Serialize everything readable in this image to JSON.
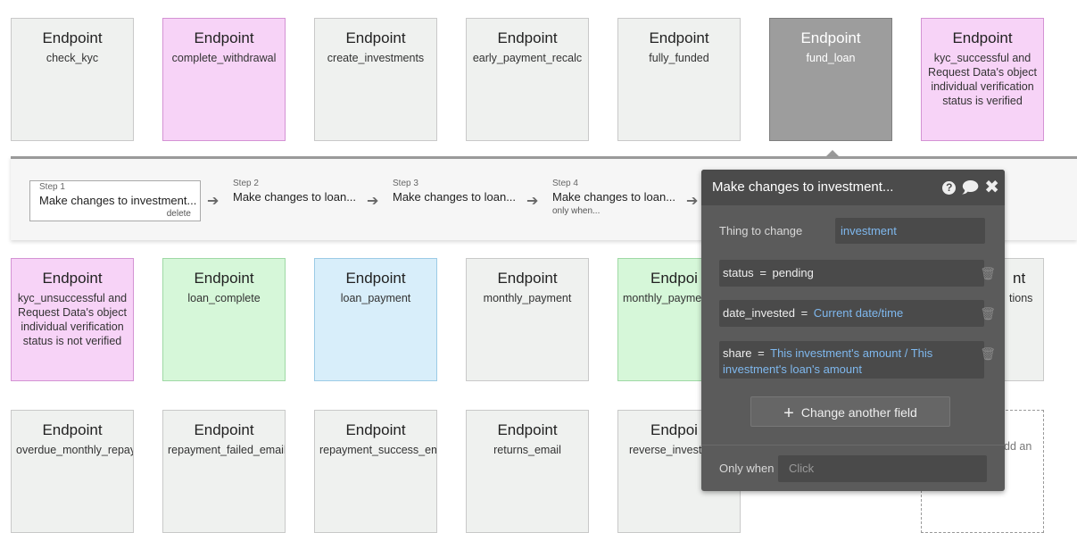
{
  "cards_row1": [
    {
      "title": "Endpoint",
      "sub": "check_kyc"
    },
    {
      "title": "Endpoint",
      "sub": "complete_withdrawal"
    },
    {
      "title": "Endpoint",
      "sub": "create_investments"
    },
    {
      "title": "Endpoint",
      "sub": "early_payment_recalc"
    },
    {
      "title": "Endpoint",
      "sub": "fully_funded"
    },
    {
      "title": "Endpoint",
      "sub": "fund_loan"
    },
    {
      "title": "Endpoint",
      "sub": "kyc_successful and Request Data's object individual verification status is verified"
    }
  ],
  "cards_row2": [
    {
      "title": "Endpoint",
      "sub": "kyc_unsuccessful and Request Data's object individual verification status is not verified"
    },
    {
      "title": "Endpoint",
      "sub": "loan_complete"
    },
    {
      "title": "Endpoint",
      "sub": "loan_payment"
    },
    {
      "title": "Endpoint",
      "sub": "monthly_payment"
    },
    {
      "title": "Endpoi",
      "sub": "monthly_payme"
    },
    {
      "title": "nt",
      "sub": "tions"
    }
  ],
  "cards_row3": [
    {
      "title": "Endpoint",
      "sub": "overdue_monthly_repay"
    },
    {
      "title": "Endpoint",
      "sub": "repayment_failed_email"
    },
    {
      "title": "Endpoint",
      "sub": "repayment_success_em"
    },
    {
      "title": "Endpoint",
      "sub": "returns_email"
    },
    {
      "title": "Endpoi",
      "sub": "reverse_invest"
    },
    {
      "title": "",
      "sub": "dd an"
    }
  ],
  "workflow": {
    "steps": [
      {
        "label": "Step 1",
        "name": "Make changes to investment...",
        "sub": "delete"
      },
      {
        "label": "Step 2",
        "name": "Make changes to loan...",
        "sub": ""
      },
      {
        "label": "Step 3",
        "name": "Make changes to loan...",
        "sub": ""
      },
      {
        "label": "Step 4",
        "name": "Make changes to loan...",
        "sub": "only when..."
      }
    ]
  },
  "panel": {
    "title": "Make changes to investment...",
    "help_icon": "?",
    "thing_label": "Thing to change",
    "thing_value": "investment",
    "fields": [
      {
        "name": "status",
        "eq": "=",
        "value": "pending"
      },
      {
        "name": "date_invested",
        "eq": "=",
        "value": "Current date/time"
      },
      {
        "name": "share",
        "eq": "=",
        "value": "This investment's amount / This investment's loan's amount"
      }
    ],
    "add_button": "Change another field",
    "only_when_label": "Only when",
    "only_when_value": "Click"
  },
  "colors": {
    "pink_card": "#f7d3f7",
    "green_card": "#d6f7d9",
    "blue_card": "#d8eefa",
    "gray_card": "#eff1ef",
    "selected_card": "#9d9d9d",
    "panel_bg": "#5b5b5b",
    "expression_blue": "#7fb8ee"
  }
}
